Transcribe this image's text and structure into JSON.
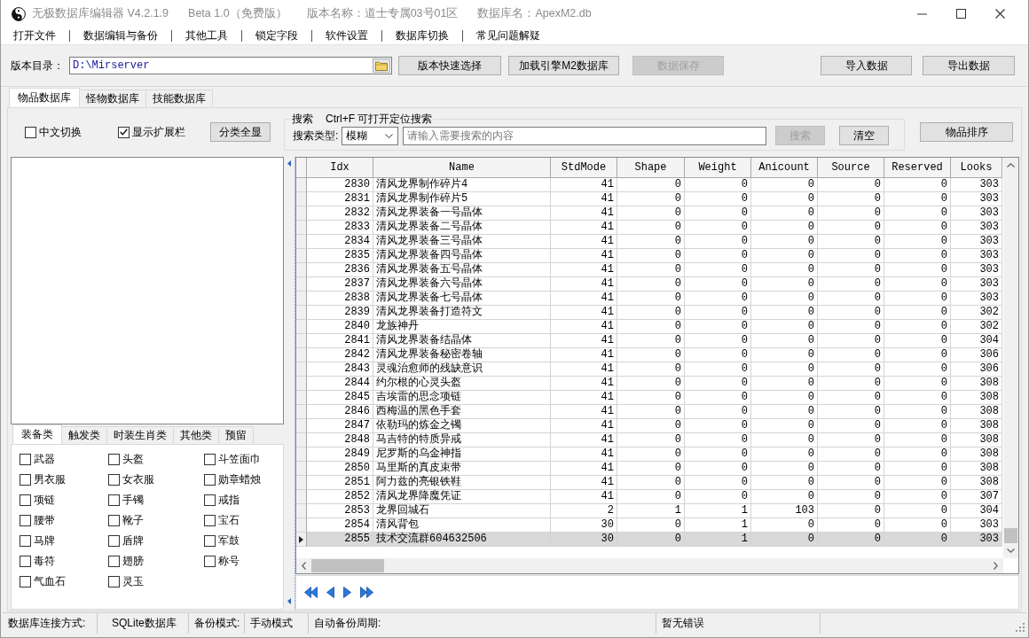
{
  "window": {
    "title_parts": [
      "无极数据库编辑器 V4.2.1.9",
      "Beta 1.0（免费版）",
      "版本名称：道士专属03号01区",
      "数据库名：ApexM2.db"
    ]
  },
  "menu": [
    "打开文件",
    "数据编辑与备份",
    "其他工具",
    "锁定字段",
    "软件设置",
    "数据库切换",
    "常见问题解疑"
  ],
  "toolbar": {
    "directory_label": "版本目录：",
    "directory_value": "D:\\Mirserver",
    "buttons": [
      {
        "label": "版本快速选择",
        "disabled": false
      },
      {
        "label": "加载引擎M2数据库",
        "disabled": false
      },
      {
        "label": "数据保存",
        "disabled": true
      }
    ],
    "data_buttons": [
      {
        "label": "导入数据",
        "disabled": false
      },
      {
        "label": "导出数据",
        "disabled": false
      }
    ]
  },
  "tabs": [
    {
      "label": "物品数据库",
      "selected": true
    },
    {
      "label": "怪物数据库",
      "selected": false
    },
    {
      "label": "技能数据库",
      "selected": false
    }
  ],
  "options": {
    "checkboxes": [
      {
        "label": "中文切换",
        "checked": false
      },
      {
        "label": "显示扩展栏",
        "checked": true
      }
    ],
    "show_all_button": "分类全显"
  },
  "search": {
    "group_title": "搜索",
    "hint": "Ctrl+F 可打开定位搜索",
    "type_label": "搜索类型:",
    "type_value": "模糊",
    "placeholder": "请输入需要搜索的内容",
    "buttons": [
      {
        "label": "搜索",
        "disabled": true
      },
      {
        "label": "清空",
        "disabled": false
      }
    ]
  },
  "sort_button": "物品排序",
  "category_tabs": [
    {
      "label": "装备类",
      "selected": true
    },
    {
      "label": "触发类",
      "selected": false
    },
    {
      "label": "时装生肖类",
      "selected": false
    },
    {
      "label": "其他类",
      "selected": false
    },
    {
      "label": "预留",
      "selected": false
    }
  ],
  "categories": [
    {
      "label": "武器",
      "checked": false
    },
    {
      "label": "头盔",
      "checked": false
    },
    {
      "label": "斗笠面巾",
      "checked": false
    },
    {
      "label": "男衣服",
      "checked": false
    },
    {
      "label": "女衣服",
      "checked": false
    },
    {
      "label": "勋章蜡烛",
      "checked": false
    },
    {
      "label": "项链",
      "checked": false
    },
    {
      "label": "手镯",
      "checked": false
    },
    {
      "label": "戒指",
      "checked": false
    },
    {
      "label": "腰带",
      "checked": false
    },
    {
      "label": "靴子",
      "checked": false
    },
    {
      "label": "宝石",
      "checked": false
    },
    {
      "label": "马牌",
      "checked": false
    },
    {
      "label": "盾牌",
      "checked": false
    },
    {
      "label": "军鼓",
      "checked": false
    },
    {
      "label": "毒符",
      "checked": false
    },
    {
      "label": "翅膀",
      "checked": false
    },
    {
      "label": "称号",
      "checked": false
    },
    {
      "label": "气血石",
      "checked": false
    },
    {
      "label": "灵玉",
      "checked": false
    }
  ],
  "table": {
    "columns": [
      "Idx",
      "Name",
      "StdMode",
      "Shape",
      "Weight",
      "Anicount",
      "Source",
      "Reserved",
      "Looks"
    ],
    "rows": [
      {
        "cells": [
          "2830",
          "清风龙界制作碎片4",
          "41",
          "0",
          "0",
          "0",
          "0",
          "0",
          "303"
        ],
        "selected": false
      },
      {
        "cells": [
          "2831",
          "清风龙界制作碎片5",
          "41",
          "0",
          "0",
          "0",
          "0",
          "0",
          "303"
        ],
        "selected": false
      },
      {
        "cells": [
          "2832",
          "清风龙界装备一号晶体",
          "41",
          "0",
          "0",
          "0",
          "0",
          "0",
          "303"
        ],
        "selected": false
      },
      {
        "cells": [
          "2833",
          "清风龙界装备二号晶体",
          "41",
          "0",
          "0",
          "0",
          "0",
          "0",
          "303"
        ],
        "selected": false
      },
      {
        "cells": [
          "2834",
          "清风龙界装备三号晶体",
          "41",
          "0",
          "0",
          "0",
          "0",
          "0",
          "303"
        ],
        "selected": false
      },
      {
        "cells": [
          "2835",
          "清风龙界装备四号晶体",
          "41",
          "0",
          "0",
          "0",
          "0",
          "0",
          "303"
        ],
        "selected": false
      },
      {
        "cells": [
          "2836",
          "清风龙界装备五号晶体",
          "41",
          "0",
          "0",
          "0",
          "0",
          "0",
          "303"
        ],
        "selected": false
      },
      {
        "cells": [
          "2837",
          "清风龙界装备六号晶体",
          "41",
          "0",
          "0",
          "0",
          "0",
          "0",
          "303"
        ],
        "selected": false
      },
      {
        "cells": [
          "2838",
          "清风龙界装备七号晶体",
          "41",
          "0",
          "0",
          "0",
          "0",
          "0",
          "303"
        ],
        "selected": false
      },
      {
        "cells": [
          "2839",
          "清风龙界装备打造符文",
          "41",
          "0",
          "0",
          "0",
          "0",
          "0",
          "302"
        ],
        "selected": false
      },
      {
        "cells": [
          "2840",
          "龙族神丹",
          "41",
          "0",
          "0",
          "0",
          "0",
          "0",
          "302"
        ],
        "selected": false
      },
      {
        "cells": [
          "2841",
          "清风龙界装备结晶体",
          "41",
          "0",
          "0",
          "0",
          "0",
          "0",
          "304"
        ],
        "selected": false
      },
      {
        "cells": [
          "2842",
          "清风龙界装备秘密卷轴",
          "41",
          "0",
          "0",
          "0",
          "0",
          "0",
          "306"
        ],
        "selected": false
      },
      {
        "cells": [
          "2843",
          "灵魂治愈师的残缺意识",
          "41",
          "0",
          "0",
          "0",
          "0",
          "0",
          "306"
        ],
        "selected": false
      },
      {
        "cells": [
          "2844",
          "约尔根的心灵头盔",
          "41",
          "0",
          "0",
          "0",
          "0",
          "0",
          "308"
        ],
        "selected": false
      },
      {
        "cells": [
          "2845",
          "吉埃雷的思念项链",
          "41",
          "0",
          "0",
          "0",
          "0",
          "0",
          "308"
        ],
        "selected": false
      },
      {
        "cells": [
          "2846",
          "西梅温的黑色手套",
          "41",
          "0",
          "0",
          "0",
          "0",
          "0",
          "308"
        ],
        "selected": false
      },
      {
        "cells": [
          "2847",
          "依勒玛的炼金之镯",
          "41",
          "0",
          "0",
          "0",
          "0",
          "0",
          "308"
        ],
        "selected": false
      },
      {
        "cells": [
          "2848",
          "马吉特的特质异戒",
          "41",
          "0",
          "0",
          "0",
          "0",
          "0",
          "308"
        ],
        "selected": false
      },
      {
        "cells": [
          "2849",
          "尼罗斯的乌金神指",
          "41",
          "0",
          "0",
          "0",
          "0",
          "0",
          "308"
        ],
        "selected": false
      },
      {
        "cells": [
          "2850",
          "马里斯的真皮束带",
          "41",
          "0",
          "0",
          "0",
          "0",
          "0",
          "308"
        ],
        "selected": false
      },
      {
        "cells": [
          "2851",
          "阿力兹的亮银铁鞋",
          "41",
          "0",
          "0",
          "0",
          "0",
          "0",
          "308"
        ],
        "selected": false
      },
      {
        "cells": [
          "2852",
          "清风龙界降魔凭证",
          "41",
          "0",
          "0",
          "0",
          "0",
          "0",
          "307"
        ],
        "selected": false
      },
      {
        "cells": [
          "2853",
          "龙界回城石",
          "2",
          "1",
          "1",
          "103",
          "0",
          "0",
          "304"
        ],
        "selected": false
      },
      {
        "cells": [
          "2854",
          "清风背包",
          "30",
          "0",
          "1",
          "0",
          "0",
          "0",
          "303"
        ],
        "selected": false
      },
      {
        "cells": [
          "2855",
          "技术交流群604632506",
          "30",
          "0",
          "1",
          "0",
          "0",
          "0",
          "303"
        ],
        "selected": true
      }
    ]
  },
  "status_bar": [
    "数据库连接方式:",
    "SQLite数据库",
    "备份模式:",
    "手动模式",
    "自动备份周期:",
    "暂无错误"
  ]
}
